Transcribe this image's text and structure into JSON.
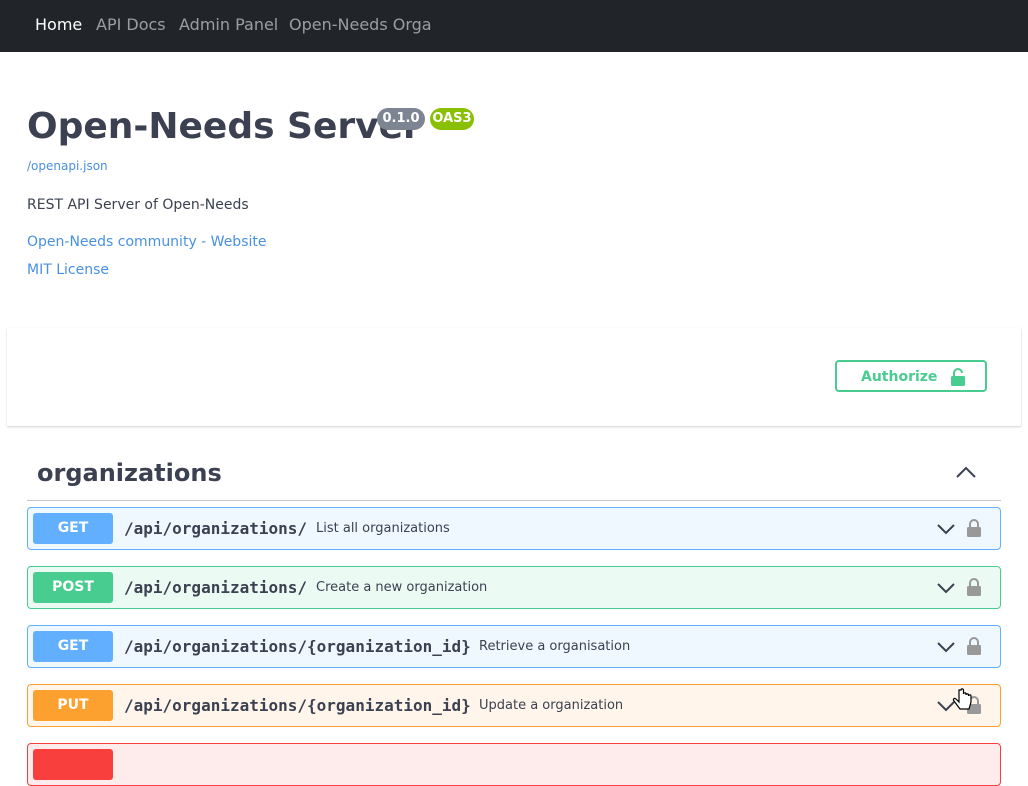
{
  "nav": {
    "items": [
      "Home",
      "API Docs",
      "Admin Panel",
      "Open-Needs Orga"
    ]
  },
  "info": {
    "title": "Open-Needs Server",
    "version": "0.1.0",
    "oas": "OAS3",
    "spec_link": "/openapi.json",
    "description": "REST API Server of Open-Needs",
    "website_link": "Open-Needs community - Website",
    "license_link": "MIT License"
  },
  "authorize": {
    "label": "Authorize",
    "icon": "unlock-icon"
  },
  "tag": {
    "name": "organizations",
    "toggle_icon": "chevron-up-icon"
  },
  "operations": [
    {
      "method": "GET",
      "path": "/api/organizations/",
      "summary": "List all organizations"
    },
    {
      "method": "POST",
      "path": "/api/organizations/",
      "summary": "Create a new organization"
    },
    {
      "method": "GET",
      "path": "/api/organizations/{organization_id}",
      "summary": "Retrieve a organisation"
    },
    {
      "method": "PUT",
      "path": "/api/organizations/{organization_id}",
      "summary": "Update a organization"
    },
    {
      "method": "",
      "path": "",
      "summary": ""
    }
  ],
  "colors": {
    "get": "#61affe",
    "post": "#49cc90",
    "put": "#fca130",
    "delete": "#f93e3e",
    "nav_bg": "#212529",
    "link": "#4990e2"
  }
}
